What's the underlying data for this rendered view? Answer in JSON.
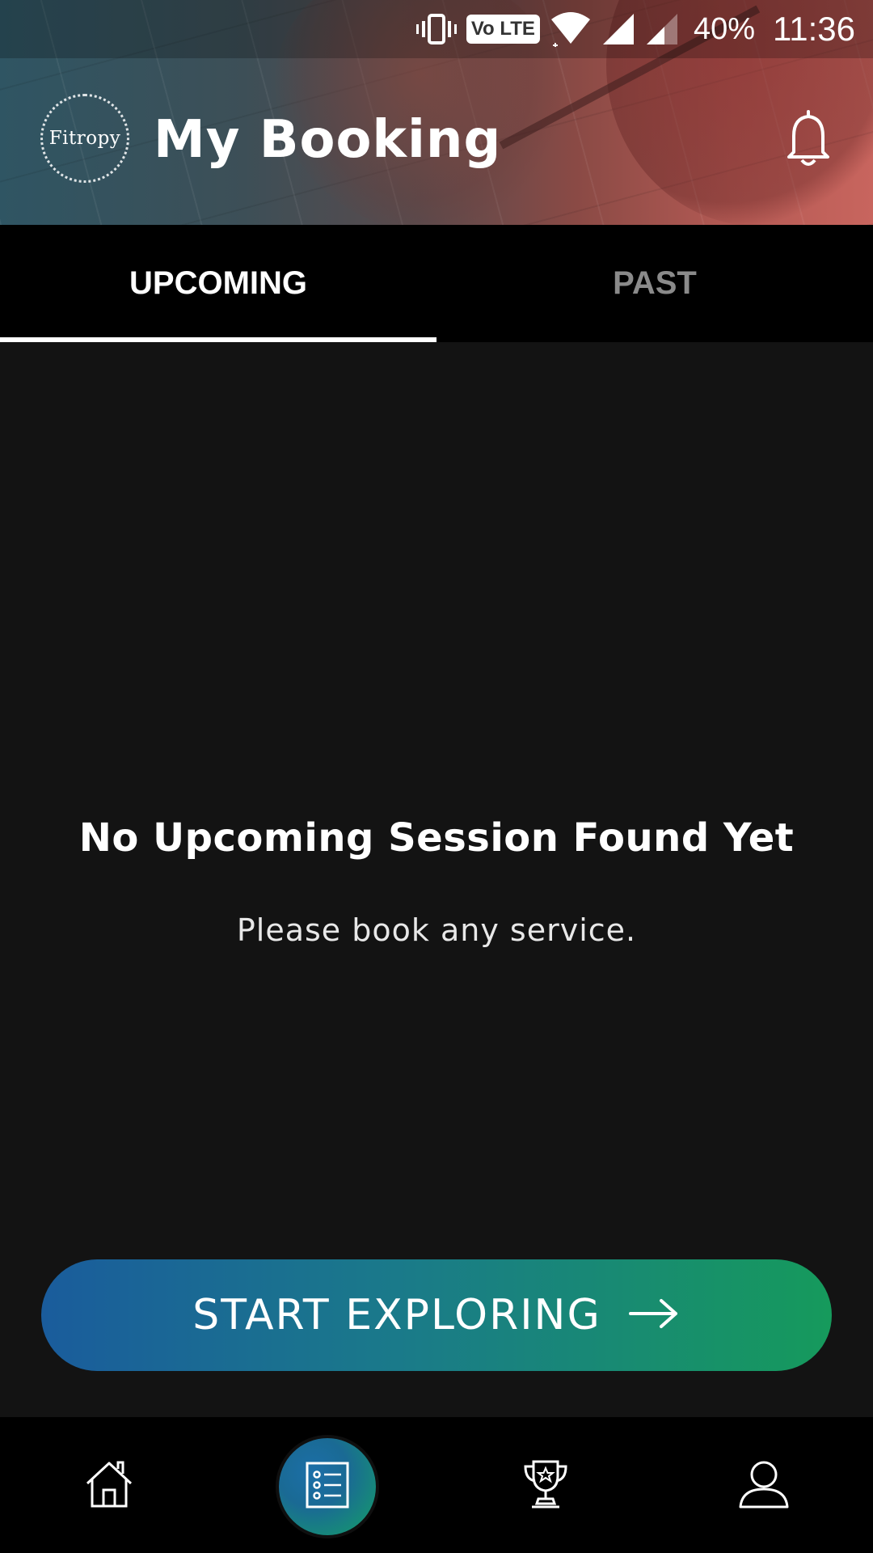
{
  "status_bar": {
    "network_badge": "Vo LTE",
    "battery": "40%",
    "time": "11:36",
    "icons": [
      "vibrate-icon",
      "volte-icon",
      "wifi-icon",
      "signal-icon",
      "signal-weak-icon"
    ]
  },
  "header": {
    "logo_text": "Fitropy",
    "title": "My Booking",
    "notification_icon": "bell-icon"
  },
  "tabs": [
    {
      "label": "UPCOMING",
      "active": true
    },
    {
      "label": "PAST",
      "active": false
    }
  ],
  "empty_state": {
    "title": "No Upcoming Session Found Yet",
    "subtitle": "Please book any service."
  },
  "cta": {
    "label": "START EXPLORING",
    "icon": "arrow-right-icon"
  },
  "bottom_nav": [
    {
      "icon": "home-icon",
      "active": false
    },
    {
      "icon": "bookings-list-icon",
      "active": true
    },
    {
      "icon": "trophy-icon",
      "active": false
    },
    {
      "icon": "profile-icon",
      "active": false
    }
  ],
  "colors": {
    "background": "#131313",
    "tab_bar": "#000000",
    "cta_gradient_start": "#1a5c9c",
    "cta_gradient_end": "#169a5c",
    "inactive_tab": "#8a8a8a"
  }
}
